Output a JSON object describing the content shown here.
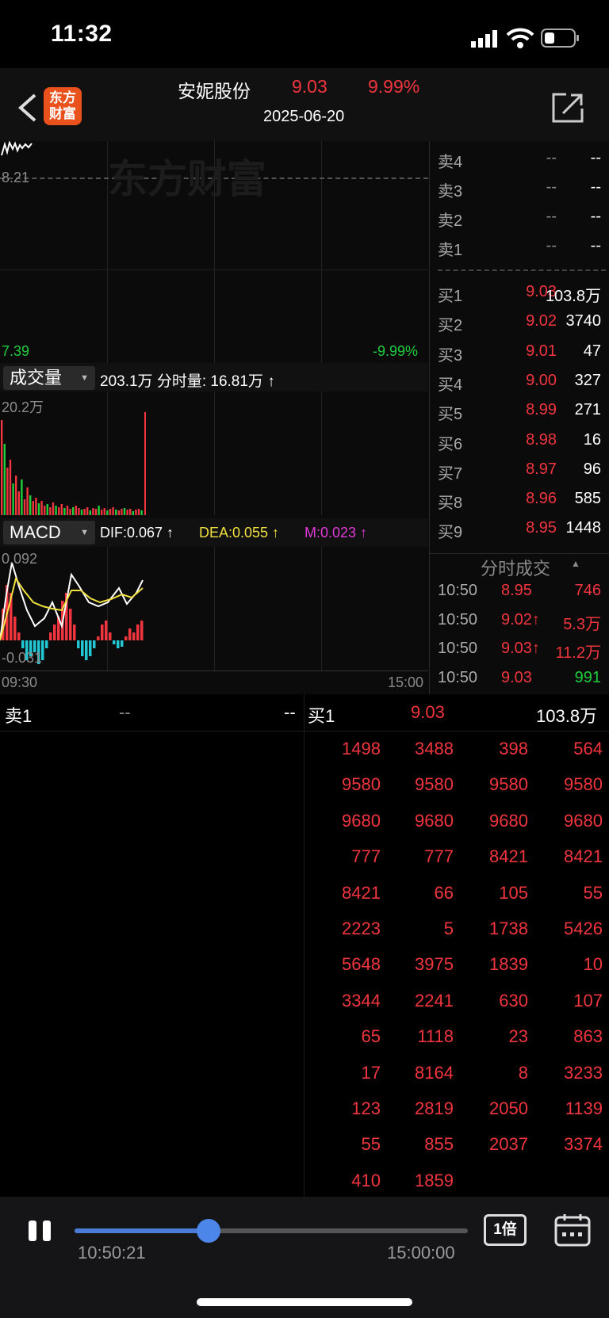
{
  "status_bar": {
    "time": "11:32"
  },
  "header": {
    "logo_line1": "东方",
    "logo_line2": "财富",
    "stock_name": "安妮股份",
    "price": "9.03",
    "change_pct": "9.99%",
    "date": "2025-06-20"
  },
  "chart": {
    "watermark": "东方财富",
    "prev_close": "8.21",
    "low_price": "7.39",
    "low_pct": "-9.99%",
    "volume_selector": "成交量",
    "volume_info": "203.1万 分时量: 16.81万 ↑",
    "volume_max": "20.2万",
    "macd_selector": "MACD",
    "dif": "DIF:0.067 ↑",
    "dea": "DEA:0.055 ↑",
    "m": "M:0.023 ↑",
    "macd_max": "0.092",
    "macd_min": "-0.031",
    "time_start": "09:30",
    "time_end": "15:00"
  },
  "order_book": {
    "asks": [
      {
        "label": "卖4",
        "price": "--",
        "vol": "--"
      },
      {
        "label": "卖3",
        "price": "--",
        "vol": "--"
      },
      {
        "label": "卖2",
        "price": "--",
        "vol": "--"
      },
      {
        "label": "卖1",
        "price": "--",
        "vol": "--"
      }
    ],
    "bids": [
      {
        "label": "买1",
        "price": "9.03",
        "vol": "103.8万"
      },
      {
        "label": "买2",
        "price": "9.02",
        "vol": "3740"
      },
      {
        "label": "买3",
        "price": "9.01",
        "vol": "47"
      },
      {
        "label": "买4",
        "price": "9.00",
        "vol": "327"
      },
      {
        "label": "买5",
        "price": "8.99",
        "vol": "271"
      },
      {
        "label": "买6",
        "price": "8.98",
        "vol": "16"
      },
      {
        "label": "买7",
        "price": "8.97",
        "vol": "96"
      },
      {
        "label": "买8",
        "price": "8.96",
        "vol": "585"
      },
      {
        "label": "买9",
        "price": "8.95",
        "vol": "1448"
      }
    ]
  },
  "trades": {
    "title": "分时成交",
    "rows": [
      {
        "time": "10:50",
        "price": "8.95",
        "vol": "746",
        "vol_color": "#f0353f"
      },
      {
        "time": "10:50",
        "price": "9.02↑",
        "vol": "5.3万",
        "vol_color": "#f0353f"
      },
      {
        "time": "10:50",
        "price": "9.03↑",
        "vol": "11.2万",
        "vol_color": "#f0353f"
      },
      {
        "time": "10:50",
        "price": "9.03",
        "vol": "991",
        "vol_color": "#1fcf3c"
      }
    ]
  },
  "lower": {
    "sell_label": "卖1",
    "sell_price": "--",
    "sell_vol": "--",
    "buy_label": "买1",
    "buy_price": "9.03",
    "buy_vol": "103.8万",
    "queue": [
      [
        "1498",
        "3488",
        "398",
        "564"
      ],
      [
        "9580",
        "9580",
        "9580",
        "9580"
      ],
      [
        "9680",
        "9680",
        "9680",
        "9680"
      ],
      [
        "777",
        "777",
        "8421",
        "8421"
      ],
      [
        "8421",
        "66",
        "105",
        "55"
      ],
      [
        "2223",
        "5",
        "1738",
        "5426"
      ],
      [
        "5648",
        "3975",
        "1839",
        "10"
      ],
      [
        "3344",
        "2241",
        "630",
        "107"
      ],
      [
        "65",
        "1118",
        "23",
        "863"
      ],
      [
        "17",
        "8164",
        "8",
        "3233"
      ],
      [
        "123",
        "2819",
        "2050",
        "1139"
      ],
      [
        "55",
        "855",
        "2037",
        "3374"
      ],
      [
        "410",
        "1859"
      ]
    ]
  },
  "playback": {
    "current_time": "10:50:21",
    "end_time": "15:00:00",
    "progress": 0.34,
    "speed_label": "1倍"
  },
  "colors": {
    "up": "#f0353f",
    "down": "#1fcf3c",
    "accent": "#4b86e8"
  }
}
